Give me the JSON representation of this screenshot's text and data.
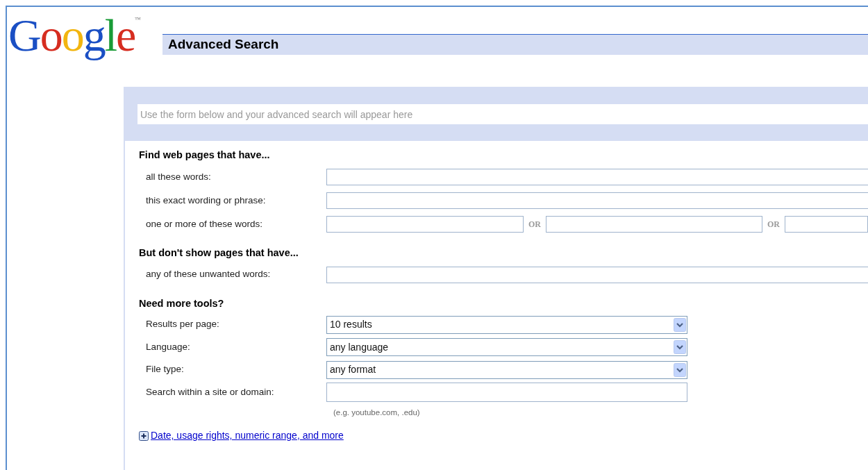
{
  "logo": {
    "text": "Google",
    "mark": "™"
  },
  "title": "Advanced Search",
  "query_preview": {
    "placeholder": "Use the form below and your advanced search will appear here"
  },
  "sections": [
    {
      "heading": "Find web pages that have...",
      "rows": [
        {
          "kind": "text",
          "label": "all these words:"
        },
        {
          "kind": "text",
          "label": "this exact wording or phrase:"
        },
        {
          "kind": "or",
          "label": "one or more of these words:",
          "separators": [
            "OR",
            "OR"
          ]
        }
      ]
    },
    {
      "heading": "But don't show pages that have...",
      "rows": [
        {
          "kind": "text",
          "label": "any of these unwanted words:"
        }
      ]
    },
    {
      "heading": "Need more tools?",
      "rows": [
        {
          "kind": "select",
          "label": "Results per page:",
          "value": "10 results"
        },
        {
          "kind": "select",
          "label": "Language:",
          "value": "any language"
        },
        {
          "kind": "select",
          "label": "File type:",
          "value": "any format"
        },
        {
          "kind": "short",
          "label": "Search within a site or domain:",
          "hint": "(e.g. youtube.com, .edu)"
        }
      ]
    }
  ],
  "more_link": "Date, usage rights, numeric range, and more"
}
